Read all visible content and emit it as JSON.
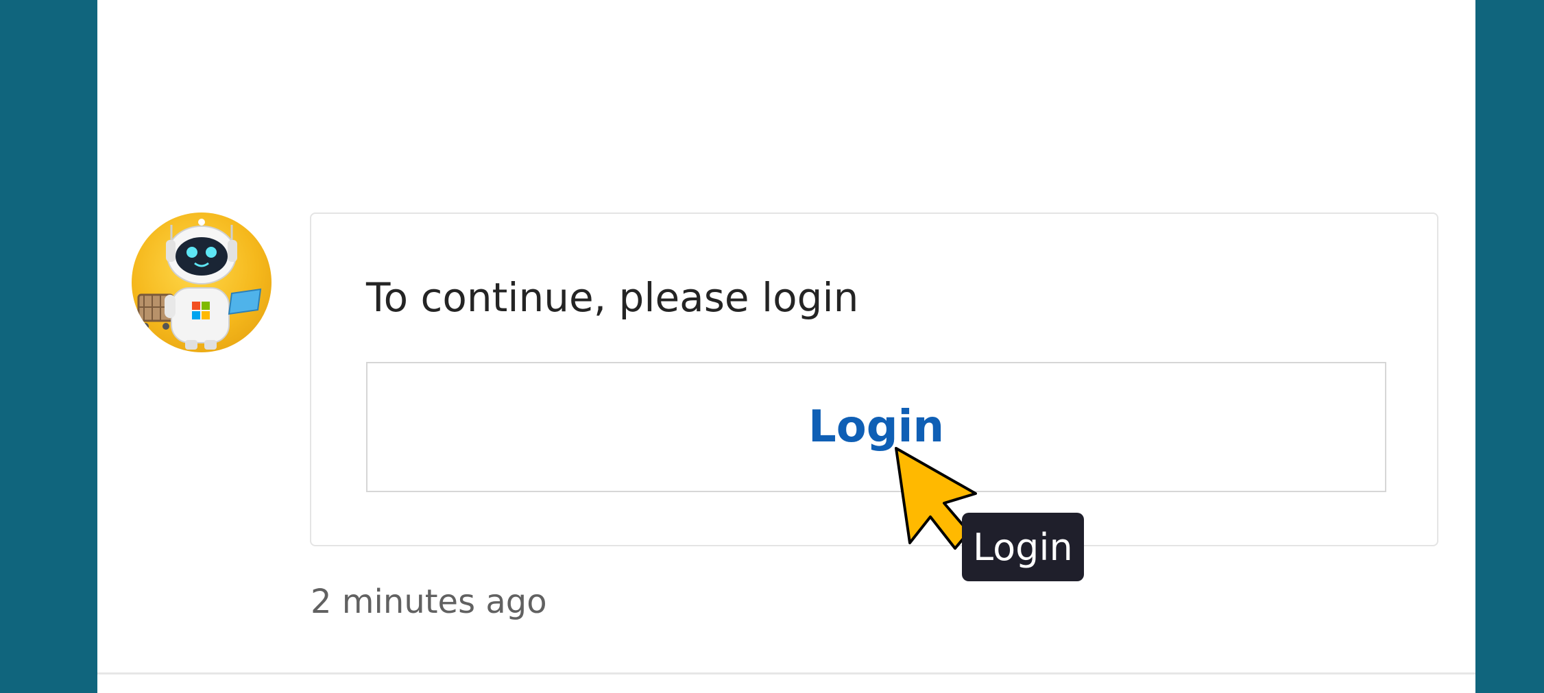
{
  "message": {
    "prompt": "To continue, please login",
    "login_button_label": "Login",
    "timestamp": "2 minutes ago"
  },
  "tooltip": {
    "text": "Login"
  },
  "avatar": {
    "icon": "robot-bot-avatar-icon"
  },
  "colors": {
    "background": "#10657d",
    "link_blue": "#0f5fb5",
    "cursor_yellow": "#ffb900",
    "tooltip_bg": "#1f1f2b"
  }
}
